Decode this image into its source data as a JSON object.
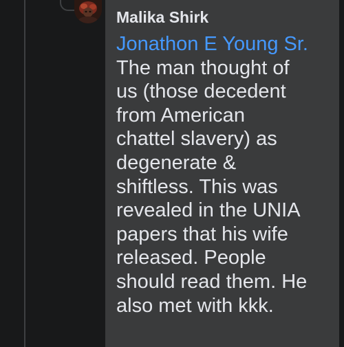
{
  "comment": {
    "author": "Malika Shirk",
    "mention": "Jonathon E Young Sr.",
    "text": "The man thought of\nus (those decedent\nfrom American\nchattel slavery) as\ndegenerate &\nshiftless. This was\nrevealed in the UNIA\npapers that his wife\nreleased. People\nshould read them. He\nalso met with kkk.",
    "avatar_icon": "profile-photo"
  },
  "colors": {
    "background": "#18191a",
    "bubble": "#3a3b3c",
    "text": "#e4e6eb",
    "mention": "#4599ff",
    "thread_line": "#3e4042"
  }
}
